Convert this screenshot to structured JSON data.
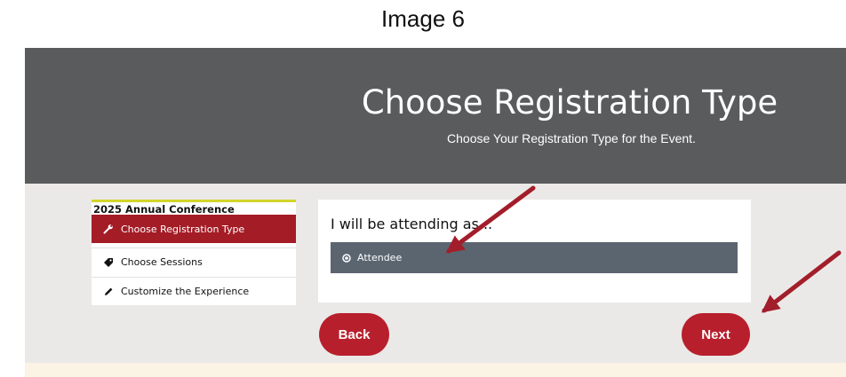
{
  "caption": "Image 6",
  "header": {
    "title": "Choose Registration Type",
    "subtitle": "Choose Your Registration Type for the Event."
  },
  "sidebar": {
    "title": "2025 Annual Conference",
    "items": [
      {
        "label": "Choose Registration Type",
        "icon": "wrench-icon",
        "active": true
      },
      {
        "label": "Choose Sessions",
        "icon": "tag-icon",
        "active": false
      },
      {
        "label": "Customize the Experience",
        "icon": "pencil-icon",
        "active": false
      }
    ]
  },
  "main": {
    "heading": "I will be attending as...",
    "options": [
      {
        "label": "Attendee",
        "icon": "radio-selected-icon",
        "selected": true
      }
    ]
  },
  "buttons": {
    "back": "Back",
    "next": "Next"
  },
  "colors": {
    "header_bg": "#595b5d",
    "content_bg": "#ebe9e7",
    "accent_red": "#b81f2c",
    "sidebar_active": "#a41c26",
    "option_bg": "#5b6570",
    "arrow": "#a21e2a",
    "sidebar_top_border": "#d3d52a"
  }
}
